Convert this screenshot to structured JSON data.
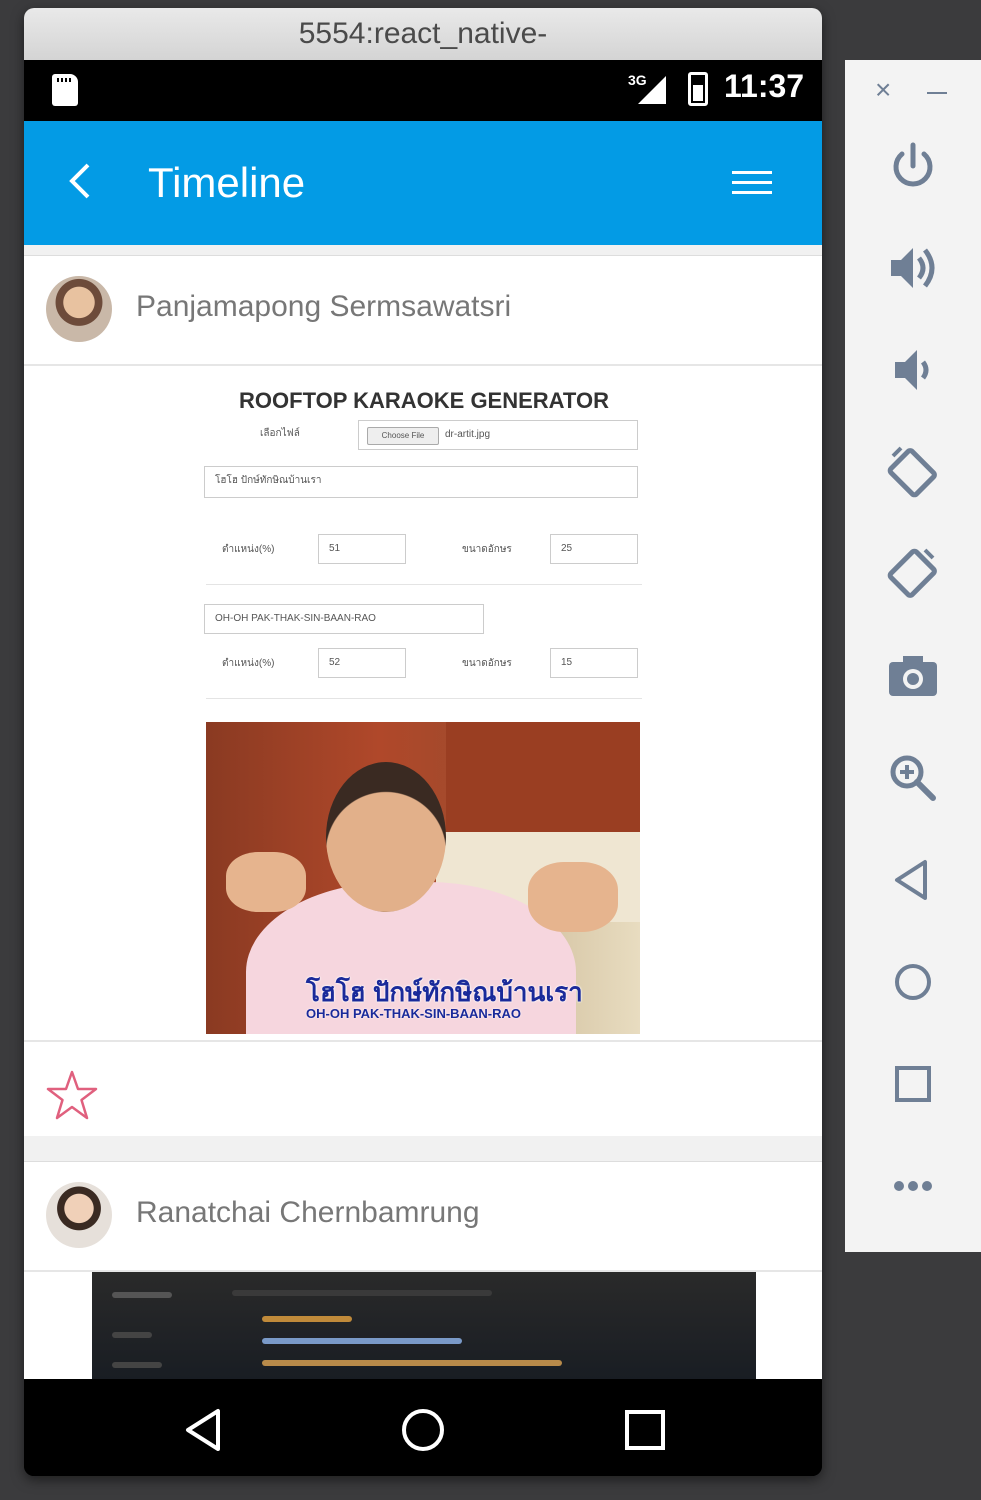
{
  "window": {
    "title": "5554:react_native-"
  },
  "status_bar": {
    "network": "3G",
    "time": "11:37"
  },
  "app_bar": {
    "title": "Timeline",
    "back_icon": "chevron-left-icon",
    "menu_icon": "hamburger-menu-icon"
  },
  "posts": [
    {
      "author": "Panjamapong Sermsawatsri",
      "image": {
        "title": "ROOFTOP KARAOKE GENERATOR",
        "file_label": "เลือกไฟล์",
        "choose_file": "Choose File",
        "file_name": "dr-artit.jpg",
        "line1_text": "โฮโฮ ปักษ์ทักษิณบ้านเรา",
        "line1_position_label": "ตำแหน่ง(%)",
        "line1_position": "51",
        "line1_size_label": "ขนาดอักษร",
        "line1_size": "25",
        "line2_text": "OH-OH PAK-THAK-SIN-BAAN-RAO",
        "line2_position_label": "ตำแหน่ง(%)",
        "line2_position": "52",
        "line2_size_label": "ขนาดอักษร",
        "line2_size": "15",
        "subtitle_thai": "โฮโฮ ปักษ์ทักษิณบ้านเรา",
        "subtitle_en": "OH-OH PAK-THAK-SIN-BAAN-RAO"
      },
      "star_icon": "star-outline-icon",
      "star_color": "#e0607e"
    },
    {
      "author": "Ranatchai Chernbamrung"
    }
  ],
  "nav_bar": {
    "back": "back-icon",
    "home": "home-icon",
    "recents": "recents-icon"
  },
  "emulator_toolbar": {
    "close": "×",
    "buttons": [
      "power-icon",
      "volume-up-icon",
      "volume-down-icon",
      "rotate-left-icon",
      "rotate-right-icon",
      "camera-icon",
      "zoom-icon",
      "back-icon",
      "home-icon",
      "overview-icon",
      "more-icon"
    ],
    "icon_color": "#6f7f95"
  },
  "colors": {
    "app_bar": "#039be5",
    "background": "#f1f1f1"
  }
}
